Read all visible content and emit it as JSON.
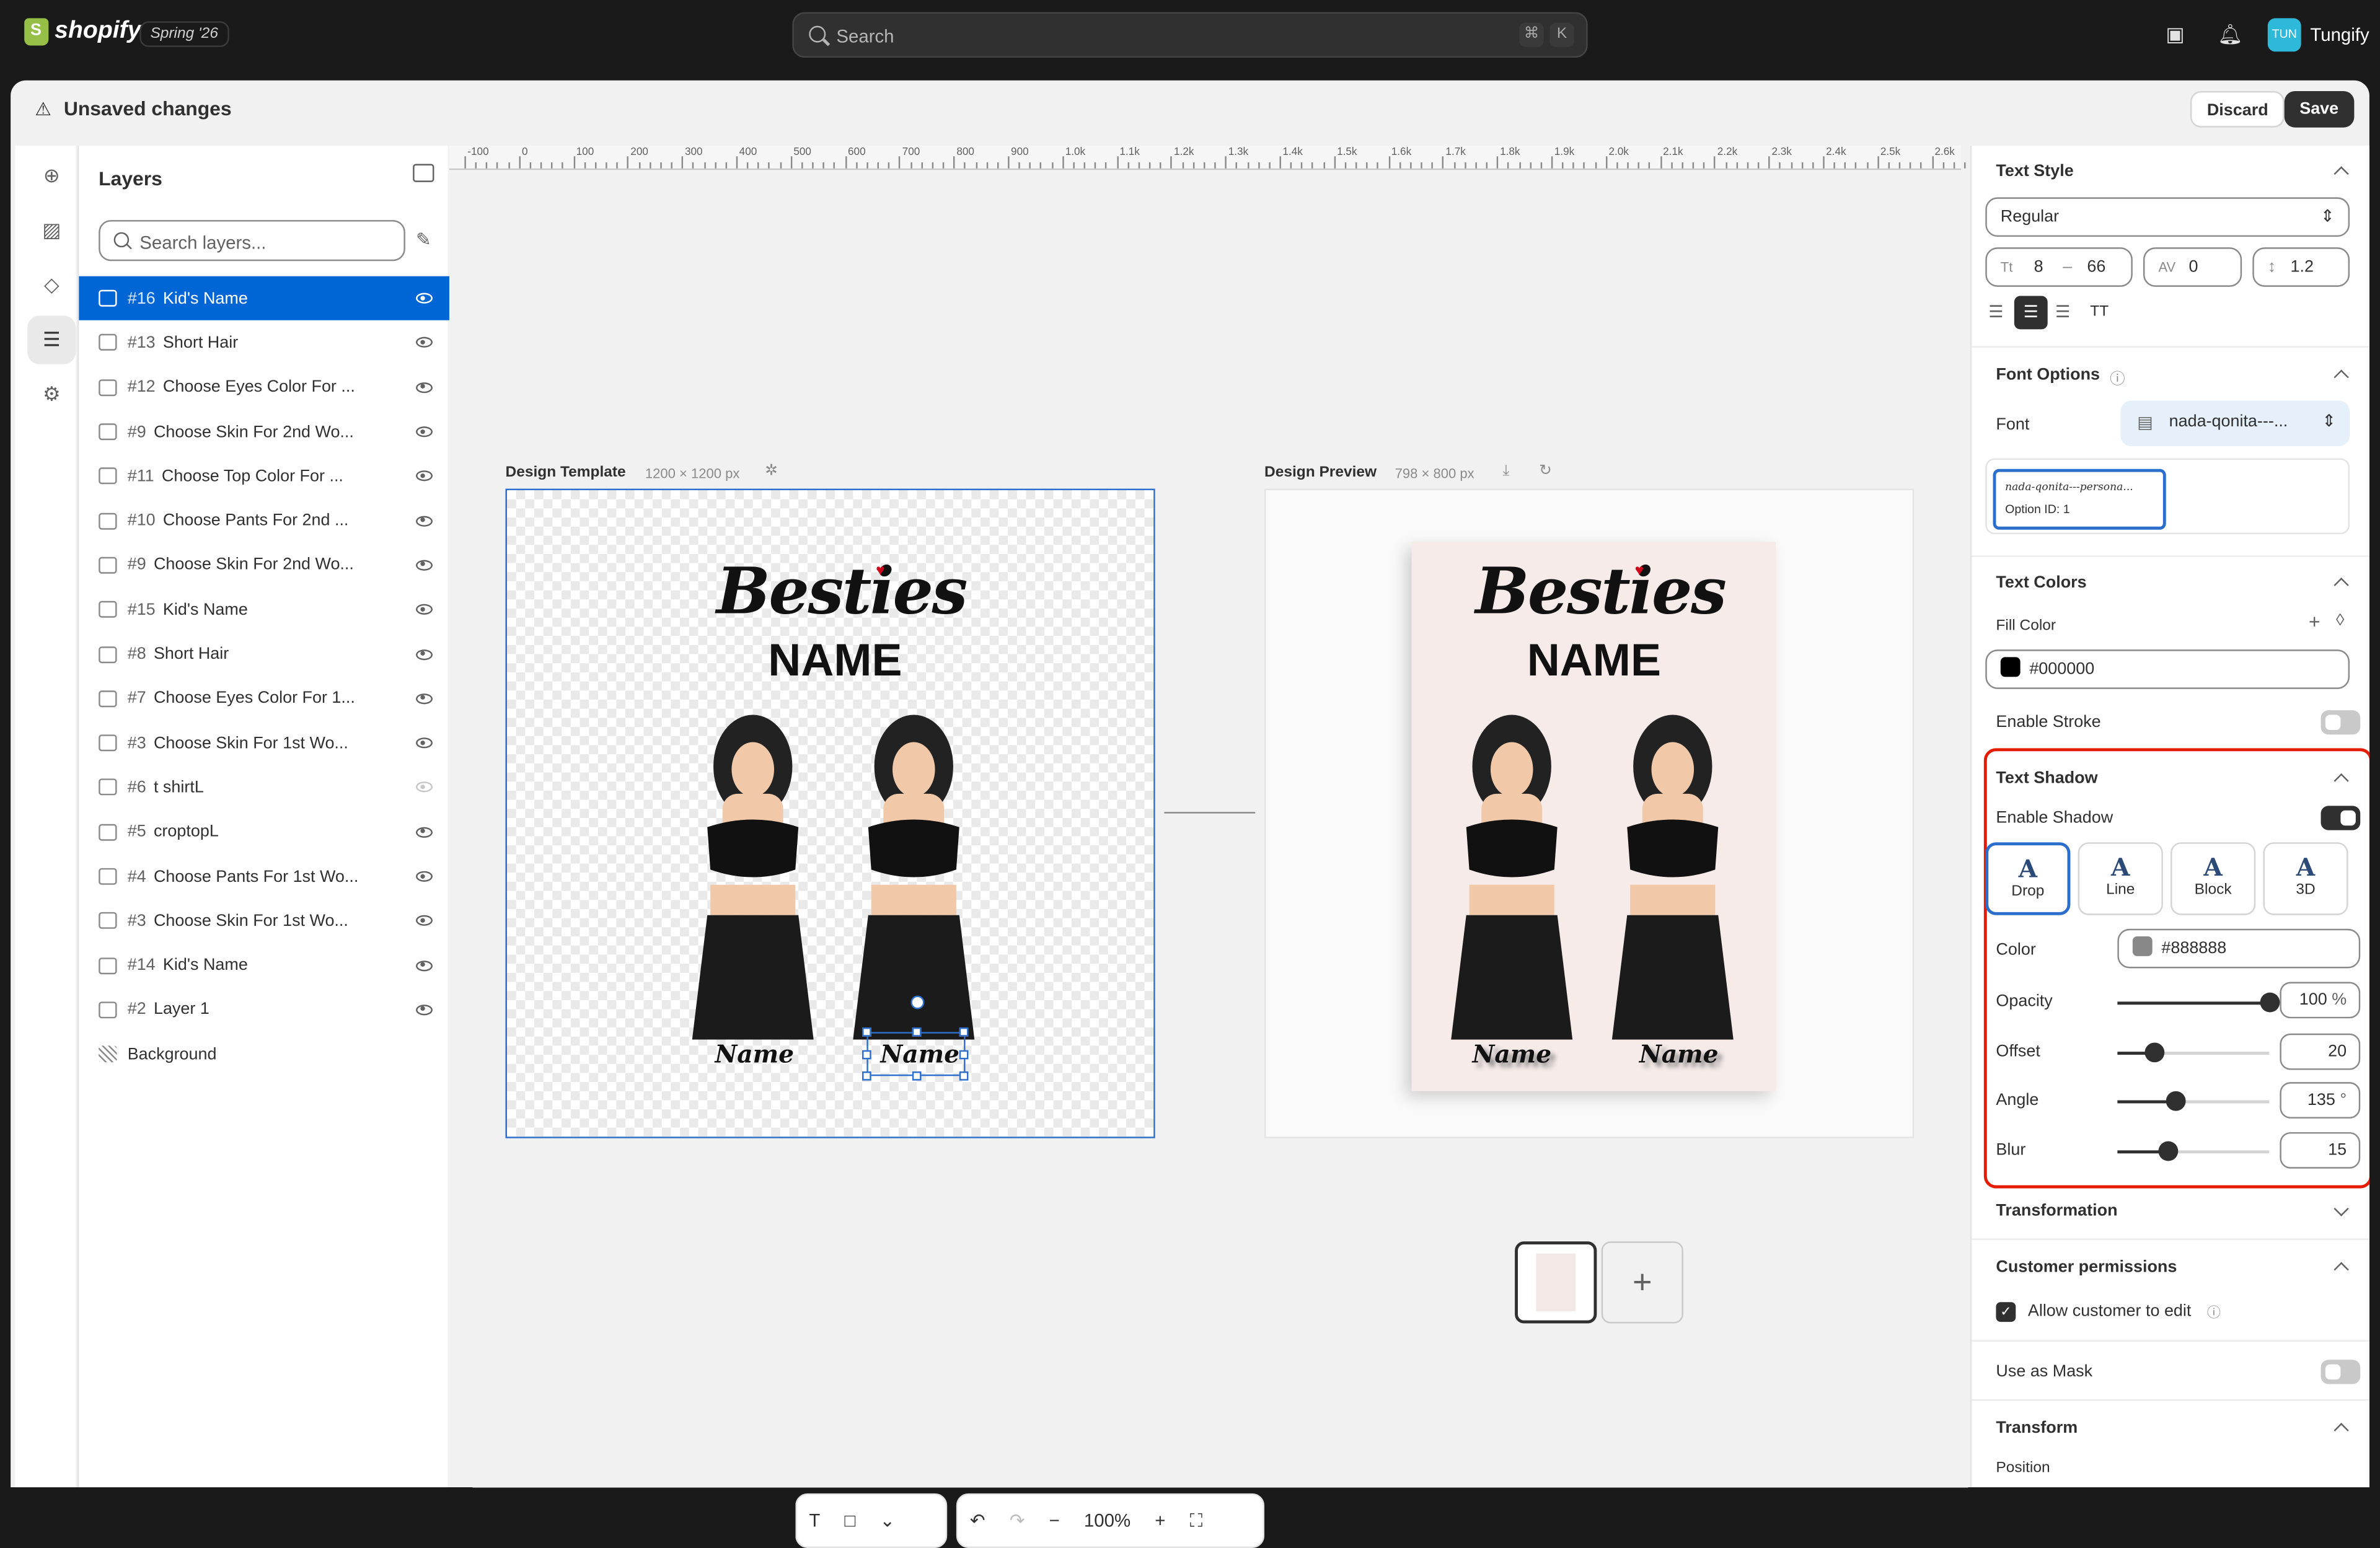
{
  "topbar": {
    "logo": "shopify",
    "edition": "Spring '26",
    "search_placeholder": "Search",
    "kbd1": "⌘",
    "kbd2": "K",
    "user_initials": "TUN",
    "user_name": "Tungify"
  },
  "savebar": {
    "title": "Unsaved changes",
    "discard": "Discard",
    "save": "Save"
  },
  "layers": {
    "title": "Layers",
    "search_placeholder": "Search layers...",
    "items": [
      {
        "num": "#16",
        "name": "Kid's Name",
        "type": "text",
        "visible": true,
        "selected": true
      },
      {
        "num": "#13",
        "name": "Short Hair",
        "type": "image",
        "visible": true
      },
      {
        "num": "#12",
        "name": "Choose Eyes Color For ...",
        "type": "image",
        "visible": true
      },
      {
        "num": "#9",
        "name": "Choose Skin For 2nd Wo...",
        "type": "image",
        "visible": true
      },
      {
        "num": "#11",
        "name": "Choose Top Color For ...",
        "type": "image",
        "visible": true
      },
      {
        "num": "#10",
        "name": "Choose Pants For 2nd ...",
        "type": "image",
        "visible": true
      },
      {
        "num": "#9",
        "name": "Choose Skin For 2nd Wo...",
        "type": "image",
        "visible": true
      },
      {
        "num": "#15",
        "name": "Kid's Name",
        "type": "text",
        "visible": true
      },
      {
        "num": "#8",
        "name": "Short Hair",
        "type": "image",
        "visible": true
      },
      {
        "num": "#7",
        "name": "Choose Eyes Color For 1...",
        "type": "image",
        "visible": true
      },
      {
        "num": "#3",
        "name": "Choose Skin For 1st Wo...",
        "type": "image",
        "visible": true
      },
      {
        "num": "#6",
        "name": "t shirtL",
        "type": "image",
        "visible": false
      },
      {
        "num": "#5",
        "name": "croptopL",
        "type": "image",
        "visible": true
      },
      {
        "num": "#4",
        "name": "Choose Pants For 1st Wo...",
        "type": "image",
        "visible": true
      },
      {
        "num": "#3",
        "name": "Choose Skin For 1st Wo...",
        "type": "image",
        "visible": true
      },
      {
        "num": "#14",
        "name": "Kid's Name",
        "type": "text",
        "visible": true
      },
      {
        "num": "#2",
        "name": "Layer 1",
        "type": "image",
        "visible": true
      },
      {
        "num": "",
        "name": "Background",
        "type": "background",
        "visible": null
      }
    ]
  },
  "canvas": {
    "ruler_labels": [
      "-100",
      "0",
      "100",
      "200",
      "300",
      "400",
      "500",
      "600",
      "700",
      "800",
      "900",
      "1.0k",
      "1.1k",
      "1.2k",
      "1.3k",
      "1.4k",
      "1.5k",
      "1.6k",
      "1.7k",
      "1.8k",
      "1.9k",
      "2.0k",
      "2.1k",
      "2.2k",
      "2.3k",
      "2.4k",
      "2.5k",
      "2.6k"
    ],
    "template_title": "Design Template",
    "template_dims": "1200 × 1200 px",
    "preview_title": "Design Preview",
    "preview_dims": "798 × 800 px",
    "design_title": "Besties",
    "design_subtitle": "NAME",
    "name_left": "Name",
    "name_right": "Name",
    "zoom": "100%"
  },
  "panel": {
    "text_style": {
      "title": "Text Style",
      "weight": "Regular",
      "font_size_min": "8",
      "font_size_sep": "–",
      "font_size_max": "66",
      "letter_spacing": "0",
      "line_height": "1.2",
      "case_label": "TT"
    },
    "font_options": {
      "title": "Font Options",
      "font_label": "Font",
      "font_value": "nada-qonita---...",
      "option_preview": "nada-qonita---persona...",
      "option_id": "Option ID: 1"
    },
    "text_colors": {
      "title": "Text Colors",
      "fill_label": "Fill Color",
      "fill_value": "#000000",
      "stroke_label": "Enable Stroke",
      "stroke_enabled": false
    },
    "text_shadow": {
      "title": "Text Shadow",
      "enable_label": "Enable Shadow",
      "enabled": true,
      "styles": [
        "Drop",
        "Line",
        "Block",
        "3D"
      ],
      "selected_style": "Drop",
      "color_label": "Color",
      "color_value": "#888888",
      "opacity_label": "Opacity",
      "opacity_value": "100",
      "opacity_unit": "%",
      "offset_label": "Offset",
      "offset_value": "20",
      "angle_label": "Angle",
      "angle_value": "135",
      "angle_unit": "°",
      "blur_label": "Blur",
      "blur_value": "15",
      "opacity_frac": 1.0,
      "offset_frac": 0.24,
      "angle_frac": 0.38,
      "blur_frac": 0.33
    },
    "transformation": {
      "title": "Transformation"
    },
    "customer_permissions": {
      "title": "Customer permissions",
      "allow_label": "Allow customer to edit",
      "allow_checked": true
    },
    "mask": {
      "label": "Use as Mask",
      "enabled": false
    },
    "transform": {
      "title": "Transform",
      "position_label": "Position"
    }
  },
  "colors": {
    "accent": "#0066d6",
    "highlight_border": "#e51c00",
    "topbar_bg": "#1a1a1a"
  }
}
